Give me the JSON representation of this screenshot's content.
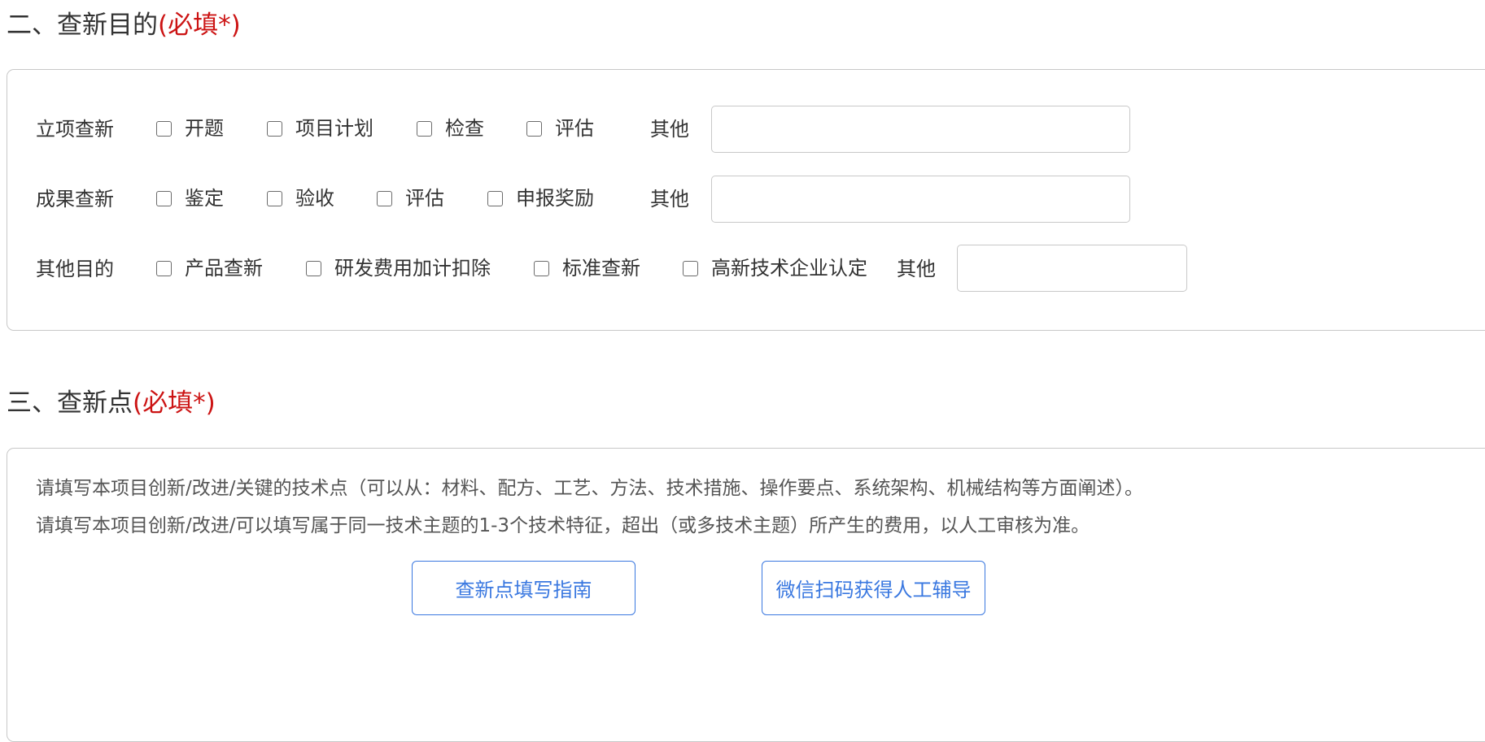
{
  "section2": {
    "title": "二、查新目的",
    "required": "(必填*)",
    "rows": [
      {
        "label": "立项查新",
        "options": [
          "开题",
          "项目计划",
          "检查",
          "评估"
        ],
        "other_label": "其他",
        "other_value": ""
      },
      {
        "label": "成果查新",
        "options": [
          "鉴定",
          "验收",
          "评估",
          "申报奖励"
        ],
        "other_label": "其他",
        "other_value": ""
      },
      {
        "label": "其他目的",
        "options": [
          "产品查新",
          "研发费用加计扣除",
          "标准查新",
          "高新技术企业认定"
        ],
        "other_label": "其他",
        "other_value": ""
      }
    ]
  },
  "section3": {
    "title": "三、查新点",
    "required": "(必填*)",
    "hints": [
      "请填写本项目创新/改进/关键的技术点（可以从：材料、配方、工艺、方法、技术措施、操作要点、系统架构、机械结构等方面阐述）。",
      "请填写本项目创新/改进/可以填写属于同一技术主题的1-3个技术特征，超出（或多技术主题）所产生的费用，以人工审核为准。"
    ],
    "buttons": {
      "guide": "查新点填写指南",
      "wechat": "微信扫码获得人工辅导"
    }
  },
  "colors": {
    "required_red": "#cc1414",
    "link_blue": "#3a78e0",
    "border_gray": "#c8c8c8"
  }
}
